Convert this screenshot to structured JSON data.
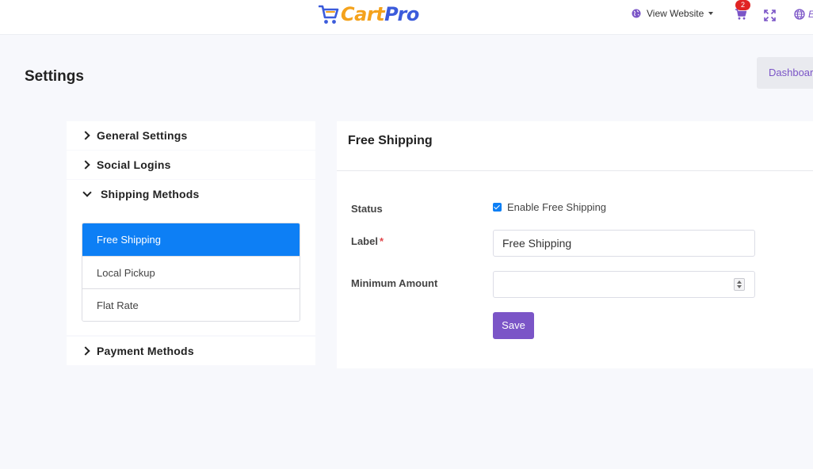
{
  "header": {
    "logo": {
      "part1": "Cart",
      "part2": "Pro"
    },
    "view_website_label": "View Website",
    "cart_count": "2",
    "language_label": "E"
  },
  "page": {
    "title": "Settings",
    "dashboard_label": "Dashboard"
  },
  "sidebar": {
    "sections": [
      {
        "label": "General Settings",
        "expanded": false
      },
      {
        "label": "Social Logins",
        "expanded": false
      },
      {
        "label": "Shipping Methods",
        "expanded": true
      },
      {
        "label": "Payment Methods",
        "expanded": false
      }
    ],
    "shipping_items": [
      {
        "label": "Free Shipping",
        "active": true
      },
      {
        "label": "Local Pickup",
        "active": false
      },
      {
        "label": "Flat Rate",
        "active": false
      }
    ]
  },
  "panel": {
    "title": "Free Shipping",
    "status_label": "Status",
    "enable_label": "Enable Free Shipping",
    "enable_checked": true,
    "label_label": "Label",
    "required_mark": "*",
    "label_value": "Free Shipping",
    "min_amount_label": "Minimum Amount",
    "min_amount_value": "",
    "save_label": "Save"
  },
  "colors": {
    "accent": "#7b55c7",
    "active": "#0d7ff5",
    "badge": "#e02424",
    "logo_cart": "#f4a21c",
    "logo_pro": "#3b5bdb"
  },
  "icons": [
    "cart-logo-icon",
    "globe-icon",
    "cart-icon",
    "expand-icon",
    "language-globe-icon",
    "chevron-right-icon",
    "chevron-down-icon",
    "checkbox-icon",
    "spinner-icon"
  ]
}
